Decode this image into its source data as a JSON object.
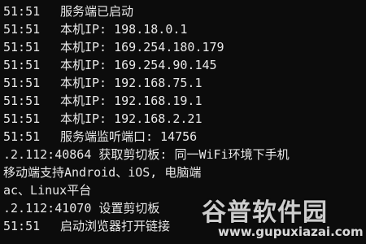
{
  "terminal": {
    "lines": [
      {
        "time": "51:51",
        "text": "服务端已启动"
      },
      {
        "time": "51:51",
        "text": "本机IP: 198.18.0.1"
      },
      {
        "time": "51:51",
        "text": "本机IP: 169.254.180.179"
      },
      {
        "time": "51:51",
        "text": "本机IP: 169.254.90.145"
      },
      {
        "time": "51:51",
        "text": "本机IP: 192.168.75.1"
      },
      {
        "time": "51:51",
        "text": "本机IP: 192.168.19.1"
      },
      {
        "time": "51:51",
        "text": "本机IP: 192.168.2.21"
      },
      {
        "time": "51:51",
        "text": "服务端监听端口: 14756"
      },
      {
        "time": "",
        "text": ".2.112:40864 获取剪切板: 同一WiFi环境下手机"
      },
      {
        "time": "",
        "text": "移动端支持Android、iOS, 电脑端"
      },
      {
        "time": "",
        "text": "ac、Linux平台"
      },
      {
        "time": "",
        "text": ".2.112:41070 设置剪切板"
      },
      {
        "time": "51:51",
        "text": "启动浏览器打开链接"
      }
    ]
  },
  "watermark": {
    "logo_text": "谷普软件园",
    "url": "www.gupuxiazai.com"
  }
}
